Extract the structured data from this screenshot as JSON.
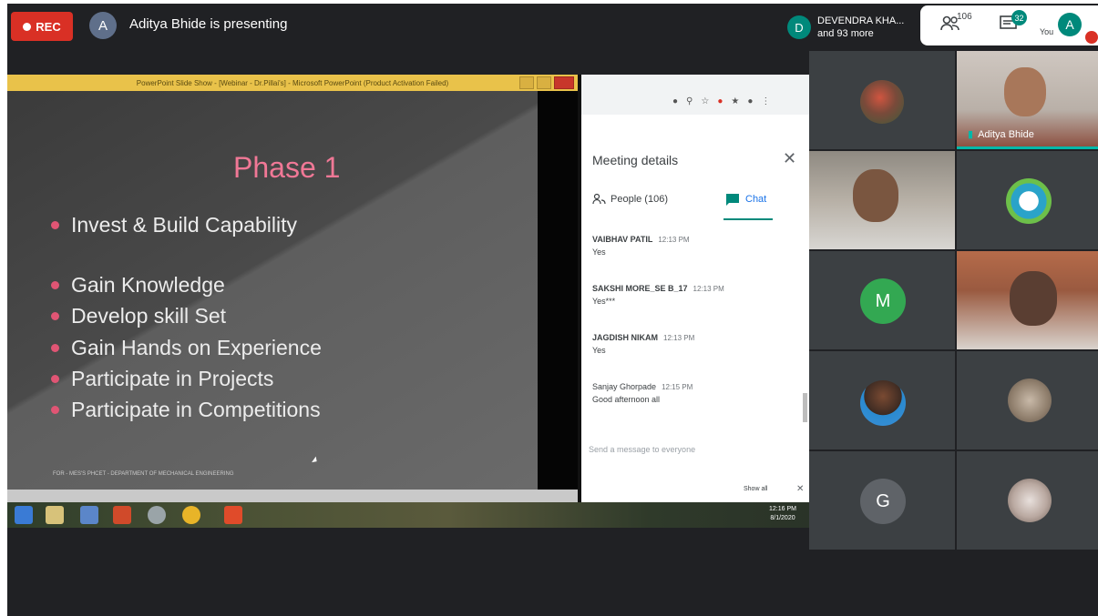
{
  "topbar": {
    "rec_label": "REC",
    "presenter_initial": "A",
    "presenter_text": "Aditya Bhide is presenting",
    "participant_chip": {
      "initial": "D",
      "name": "DEVENDRA KHA...",
      "more": "and 93 more"
    },
    "people_count": "106",
    "chat_count": "32",
    "you_label": "You",
    "self_initial": "A"
  },
  "shared_screen": {
    "ppt_window_title": "PowerPoint Slide Show - [Webinar - Dr.Pillai's] - Microsoft PowerPoint (Product Activation Failed)",
    "slide": {
      "title": "Phase 1",
      "bullets": [
        "Invest & Build Capability",
        "Gain Knowledge",
        "Develop skill Set",
        "Gain Hands on Experience",
        "Participate in Projects",
        "Participate in Competitions"
      ],
      "footer": "FOR - MES'S PHCET - DEPARTMENT OF MECHANICAL ENGINEERING"
    },
    "meeting_panel": {
      "title": "Meeting details",
      "tab_people": "People (106)",
      "tab_chat": "Chat",
      "messages": [
        {
          "sender": "VAIBHAV PATIL",
          "time": "12:13 PM",
          "text": "Yes"
        },
        {
          "sender": "SAKSHI MORE_SE B_17",
          "time": "12:13 PM",
          "text": "Yes***"
        },
        {
          "sender": "JAGDISH NIKAM",
          "time": "12:13 PM",
          "text": "Yes"
        },
        {
          "sender": "Sanjay Ghorpade",
          "time": "12:15 PM",
          "text": "Good afternoon all"
        }
      ],
      "send_placeholder": "Send a message to everyone",
      "show_all": "Show all"
    },
    "taskbar_clock": {
      "time": "12:16 PM",
      "date": "8/1/2020"
    }
  },
  "participants": {
    "speaker_name": "Aditya Bhide",
    "letters": [
      "M",
      "G"
    ]
  },
  "colors": {
    "rec": "#d93025",
    "accent_teal": "#00897b",
    "letter_m": "#33a852",
    "letter_g": "#5f6368",
    "slide_title": "#f07896"
  }
}
